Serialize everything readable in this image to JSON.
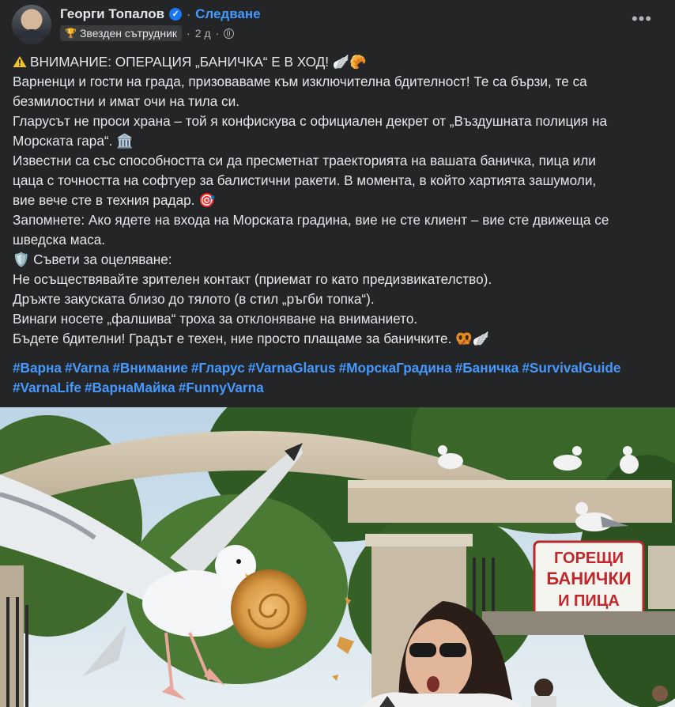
{
  "post": {
    "author": "Георги Топалов",
    "follow_label": "Следване",
    "separator": "·",
    "badge_label": "Звезден сътрудник",
    "time": "2 д",
    "more_label": "•••",
    "body_lines": [
      "ВНИМАНИЕ: ОПЕРАЦИЯ „БАНИЧКА“ Е В ХОД! 🪽🥐",
      "Варненци и гости на града, призоваваме към изключителна бдителност! Те са бързи, те са",
      "безмилостни и имат очи на тила си.",
      "Гларусът не проси храна – той я конфискува с официален декрет от „Въздушната полиция на",
      "Морската гара“. 🏛️",
      "Известни са със способността си да пресметнат траекторията на вашата баничка, пица или",
      "цаца с точността на софтуер за балистични ракети. В момента, в който хартията зашумоли,",
      "вие вече сте в техния радар. 🎯",
      "Запомнете: Ако ядете на входа на Морската градина, вие не сте клиент – вие сте движеща се",
      "шведска маса.",
      "🛡️ Съвети за оцеляване:",
      "Не осъществявайте зрителен контакт (приемат го като предизвикателство).",
      "Дръжте закуската близо до тялото (в стил „ръгби топка“).",
      "Винаги носете „фалшива“ троха за отклоняване на вниманието.",
      "Бъдете бдителни! Градът е техен, ние просто плащаме за баничките. 🥨🪽"
    ],
    "hashtags_line1": [
      "#Варна",
      "#Varna",
      "#Внимание",
      "#Гларус",
      "#VarnaGlarus",
      "#МорскаГрадина",
      "#Баничка",
      "#SurvivalGuide"
    ],
    "hashtags_line2": [
      "#VarnaLife",
      "#ВарнаМайка",
      "#FunnyVarna"
    ]
  },
  "photo": {
    "sign_lines": [
      "ГОРЕЩИ",
      "БАНИЧКИ",
      "И ПИЦА"
    ]
  },
  "icons": {
    "verified": "verified-badge-icon",
    "trophy": "trophy-icon",
    "globe": "globe-icon",
    "warning": "warning-icon",
    "more": "more-options-icon"
  },
  "colors": {
    "background": "#242526",
    "text": "#e4e6eb",
    "secondary_text": "#b0b3b8",
    "link": "#4599ff",
    "verified": "#1877f2"
  }
}
